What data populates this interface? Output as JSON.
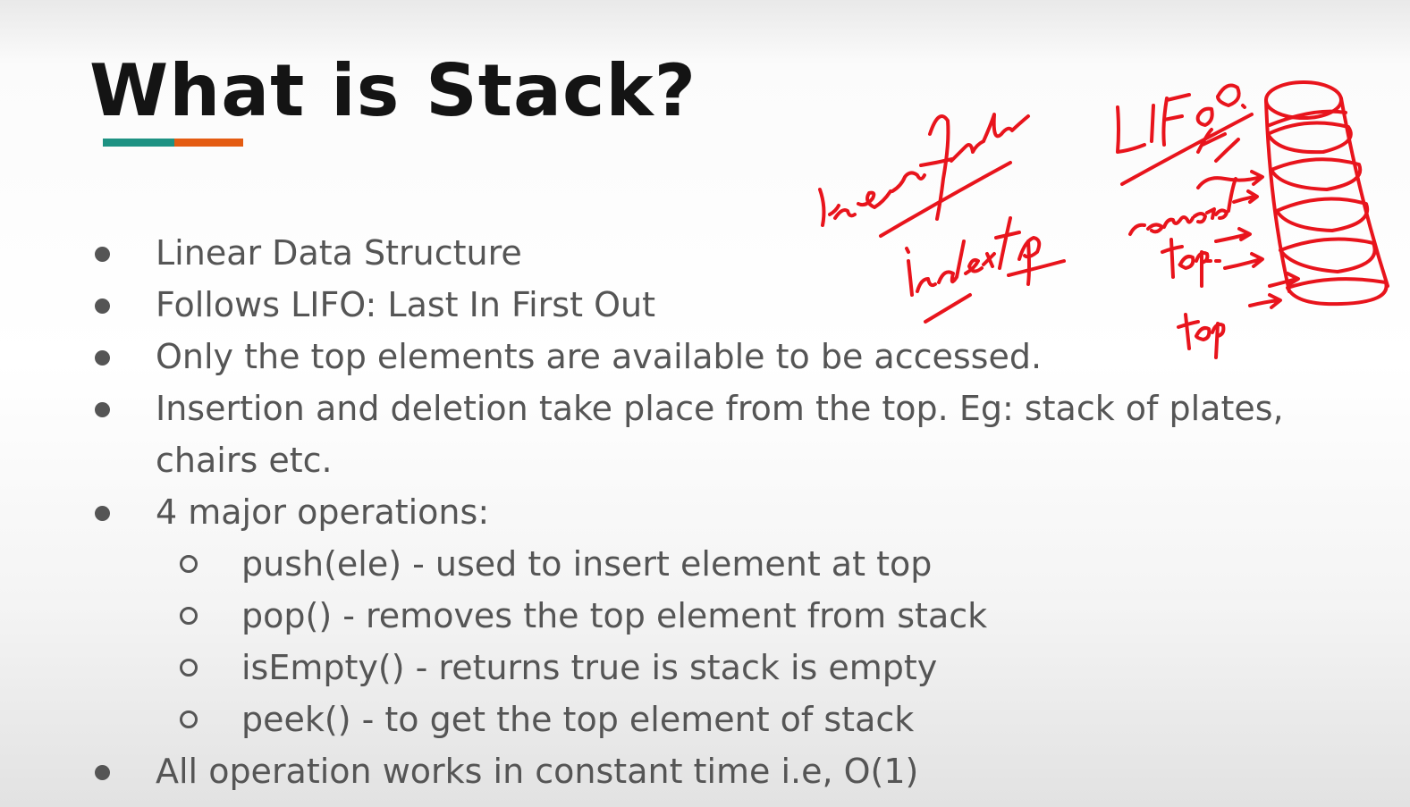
{
  "slide": {
    "title": "What is Stack?",
    "accent_colors": [
      "#1e9283",
      "#e45c12"
    ],
    "bullets": [
      "Linear Data Structure",
      "Follows LIFO: Last In First Out",
      "Only the top elements are available to be accessed.",
      "Insertion and deletion take place from the top. Eg: stack of plates, chairs etc.",
      "4 major operations:",
      "All operation works in constant time i.e, O(1)"
    ],
    "operations": [
      "push(ele) - used to insert element at top",
      "pop() - removes the top element from stack",
      "isEmpty() - returns true is stack is empty",
      "peek() - to get the top element of stack"
    ]
  },
  "annotations": {
    "ink_color": "#e8141c",
    "notes": [
      "Linear fashion",
      "index top",
      "LIFO",
      "removed",
      "top",
      "top"
    ]
  }
}
